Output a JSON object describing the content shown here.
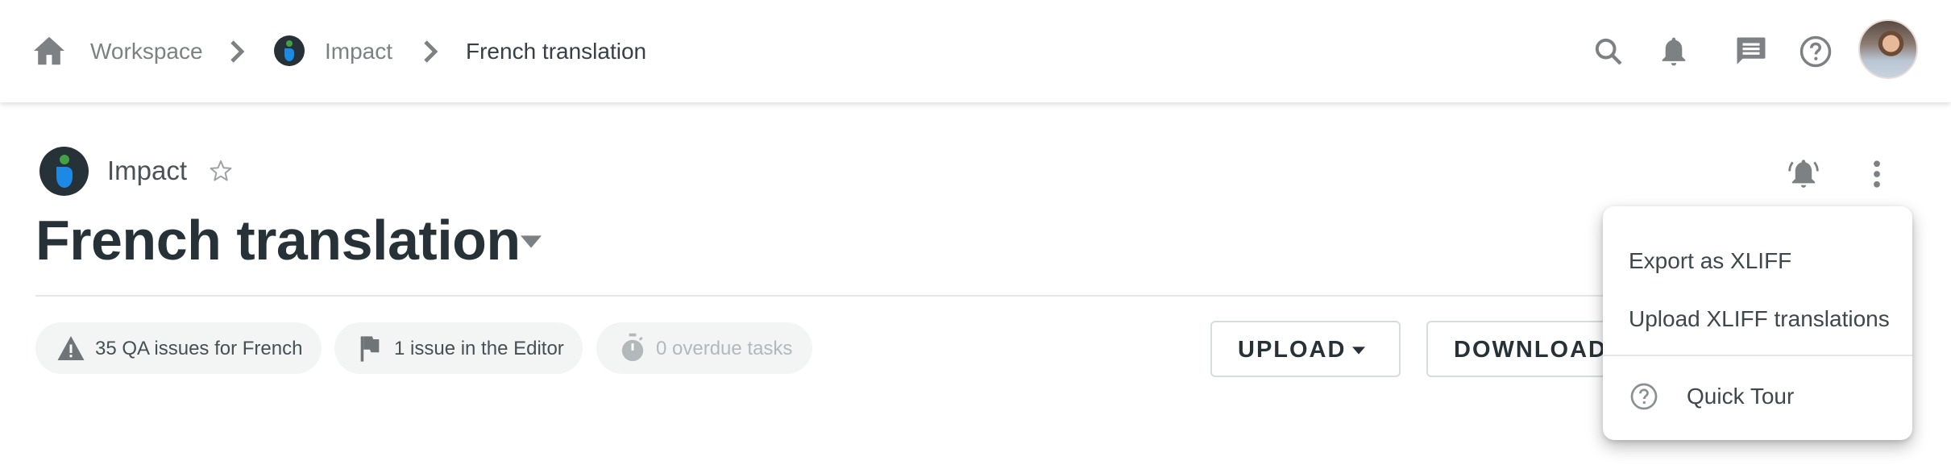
{
  "header": {
    "breadcrumb": [
      {
        "label": "Workspace",
        "icon": "home-icon"
      },
      {
        "label": "Impact",
        "icon": "project-logo"
      },
      {
        "label": "French translation"
      }
    ],
    "actions": [
      {
        "name": "search",
        "icon": "search-icon"
      },
      {
        "name": "notifications",
        "icon": "bell-icon"
      },
      {
        "name": "messages",
        "icon": "chat-icon"
      },
      {
        "name": "help",
        "icon": "help-circle-icon"
      }
    ],
    "avatar_alt": "User avatar"
  },
  "project": {
    "name": "Impact",
    "favorite_icon": "star-outline-icon"
  },
  "page": {
    "title": "French translation",
    "title_dropdown_icon": "caret-down-icon"
  },
  "chips": [
    {
      "label": "35 QA issues for French",
      "icon": "warning-icon",
      "disabled": false
    },
    {
      "label": "1 issue in the Editor",
      "icon": "flag-icon",
      "disabled": false
    },
    {
      "label": "0 overdue tasks",
      "icon": "timer-icon",
      "disabled": true
    }
  ],
  "buttons": {
    "upload": "UPLOAD",
    "download": "DOWNLOAD"
  },
  "page_actions": {
    "notify_icon": "bell-ringing-icon",
    "more_icon": "more-vertical-icon"
  },
  "menu": {
    "items": [
      {
        "label": "Export as XLIFF"
      },
      {
        "label": "Upload XLIFF translations"
      },
      {
        "label": "Quick Tour",
        "icon": "help-circle-icon"
      }
    ]
  },
  "colors": {
    "brand_dark": "#263238",
    "brand_blue": "#1e88e5",
    "brand_green": "#43a047",
    "icon_grey": "#7d8184"
  }
}
